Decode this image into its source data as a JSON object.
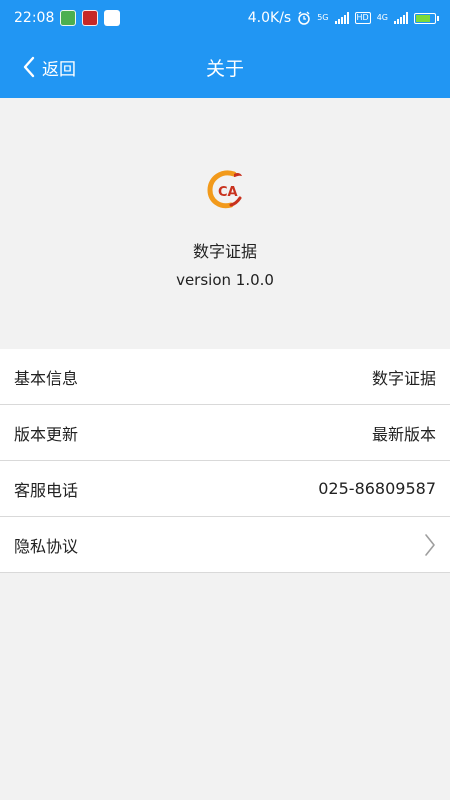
{
  "status_bar": {
    "time": "22:08",
    "net_speed": "4.0K/s",
    "net1": "5G",
    "net2": "4G",
    "hd": "HD",
    "icons": [
      "app-green-icon",
      "app-red-icon",
      "app-white-icon",
      "alarm-icon",
      "signal-icon",
      "signal-icon",
      "battery-icon"
    ]
  },
  "header": {
    "back_label": "返回",
    "title": "关于"
  },
  "about": {
    "app_name": "数字证据",
    "version": "version 1.0.0",
    "logo_text": "CA"
  },
  "list": {
    "items": [
      {
        "label": "基本信息",
        "value": "数字证据"
      },
      {
        "label": "版本更新",
        "value": "最新版本"
      },
      {
        "label": "客服电话",
        "value": "025-86809587"
      },
      {
        "label": "隐私协议",
        "value": ""
      }
    ]
  },
  "colors": {
    "accent": "#2196f3",
    "background": "#f2f2f2",
    "logo_orange": "#f29a1b",
    "logo_red": "#c8321e"
  }
}
